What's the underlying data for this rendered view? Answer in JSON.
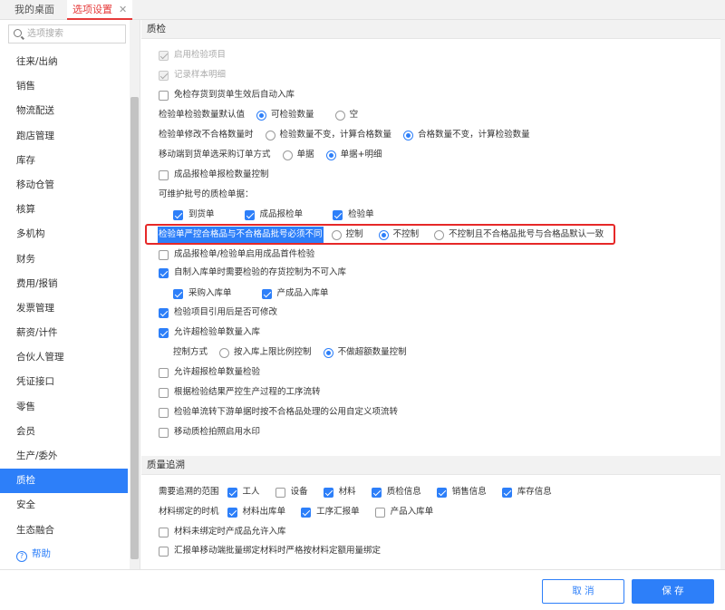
{
  "tabs": {
    "home": "我的桌面",
    "active": "选项设置",
    "close": "✕"
  },
  "search": {
    "placeholder": "选项搜索"
  },
  "sidebar": {
    "items": [
      "往来/出纳",
      "销售",
      "物流配送",
      "跑店管理",
      "库存",
      "移动仓管",
      "核算",
      "多机构",
      "财务",
      "费用/报销",
      "发票管理",
      "薪资/计件",
      "合伙人管理",
      "凭证接口",
      "零售",
      "会员",
      "生产/委外",
      "质检",
      "安全",
      "生态融合"
    ],
    "active_index": 17,
    "help": "帮助"
  },
  "qc": {
    "header": "质检",
    "enable_item": "启用检验项目",
    "record_detail": "记录样本明细",
    "auto_stock_in": "免检存货到货单生效后自动入库",
    "default_qty_label": "检验单检验数量默认值",
    "default_qty_opt1": "可检验数量",
    "default_qty_opt2": "空",
    "modify_unqualified_label": "检验单修改不合格数量时",
    "modify_opt1": "检验数量不变，计算合格数量",
    "modify_opt2": "合格数量不变，计算检验数量",
    "mobile_ref_label": "移动端到货单选采购订单方式",
    "mobile_ref_opt1": "单据",
    "mobile_ref_opt2": "单据+明细",
    "product_report_ctrl": "成品报检单报检数量控制",
    "batch_docs_label": "可维护批号的质检单据：",
    "batch_doc1": "到货单",
    "batch_doc2": "成品报检单",
    "batch_doc3": "检验单",
    "batch_consistent_label": "检验单严控合格品与不合格品批号必须不同",
    "batch_opt1": "控制",
    "batch_opt2": "不控制",
    "batch_opt3": "不控制且不合格品批号与合格品默认一致",
    "first_piece": "成品报检单/检验单启用成品首件检验",
    "self_made_ctrl": "自制入库单时需要检验的存货控制为不可入库",
    "self_made_sub1": "采购入库单",
    "self_made_sub2": "产成品入库单",
    "item_ref_locked": "检验项目引用后是否可修改",
    "allow_over_stock_in": "允许超检验单数量入库",
    "control_mode_label": "控制方式",
    "control_mode_opt1": "按入库上限比例控制",
    "control_mode_opt2": "不做超额数量控制",
    "allow_over_report": "允许超报检单数量检验",
    "strict_process": "根据检验结果严控生产过程的工序流转",
    "downstream_custom": "检验单流转下游单据时按不合格品处理的公用自定义项流转",
    "mobile_watermark": "移动质检拍照启用水印"
  },
  "trace": {
    "header": "质量追溯",
    "scope_label": "需要追溯的范围",
    "scope_items": [
      "工人",
      "设备",
      "材料",
      "质检信息",
      "销售信息",
      "库存信息"
    ],
    "bind_label": "材料绑定的时机",
    "bind_items": [
      "材料出库单",
      "工序汇报单",
      "产品入库单"
    ],
    "unbound_allow": "材料未绑定时产成品允许入库",
    "mobile_batch_bind": "汇报单移动端批量绑定材料时严格按材料定额用量绑定"
  },
  "footer": {
    "cancel": "取 消",
    "save": "保 存"
  },
  "colors": {
    "accent": "#2d7ff9",
    "tab_active": "#e63a3a",
    "highlight_box": "#e62828"
  }
}
